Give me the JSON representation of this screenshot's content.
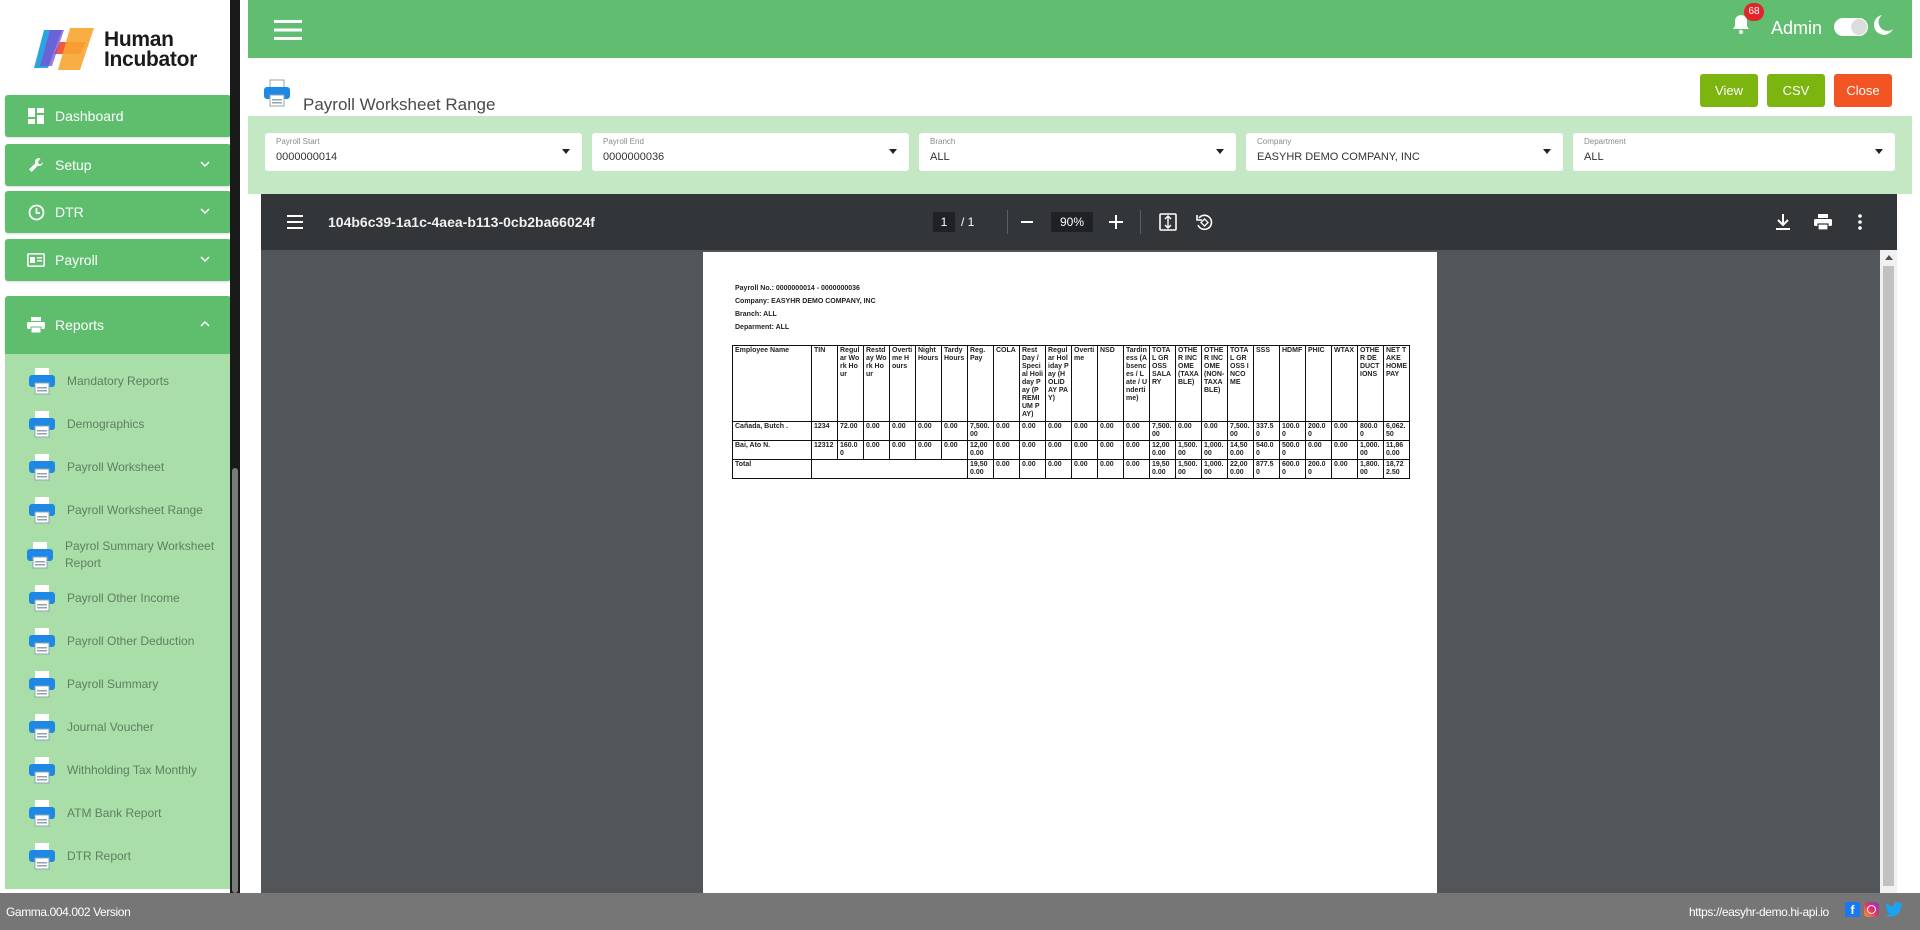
{
  "brand": {
    "logo_line1": "Human",
    "logo_line2": "Incubator"
  },
  "sidebar": {
    "menu": [
      {
        "label": "Dashboard",
        "icon": "dashboard-icon"
      },
      {
        "label": "Setup",
        "icon": "wrench-icon"
      },
      {
        "label": "DTR",
        "icon": "clock-icon"
      },
      {
        "label": "Payroll",
        "icon": "payroll-icon"
      },
      {
        "label": "Reports",
        "icon": "printer-icon"
      }
    ],
    "reports_submenu": [
      "Mandatory Reports",
      "Demographics",
      "Payroll Worksheet",
      "Payroll Worksheet Range",
      "Payrol Summary Worksheet Report",
      "Payroll Other Income",
      "Payroll Other Deduction",
      "Payroll Summary",
      "Journal Voucher",
      "Withholding Tax Monthly",
      "ATM Bank Report",
      "DTR Report"
    ]
  },
  "header": {
    "notification_count": "68",
    "user": "Admin"
  },
  "page": {
    "title": "Payroll Worksheet Range",
    "buttons": {
      "view": "View",
      "csv": "CSV",
      "close": "Close"
    }
  },
  "filters": [
    {
      "label": "Payroll Start",
      "value": "0000000014"
    },
    {
      "label": "Payroll End",
      "value": "0000000036"
    },
    {
      "label": "Branch",
      "value": "ALL"
    },
    {
      "label": "Company",
      "value": "EASYHR DEMO COMPANY, INC"
    },
    {
      "label": "Department",
      "value": "ALL"
    }
  ],
  "pdf": {
    "filename": "104b6c39-1a1c-4aea-b113-0cb2ba66024f",
    "page_current": "1",
    "page_total": "/ 1",
    "zoom": "90%",
    "meta": {
      "payroll_no": "Payroll No.: 0000000014 - 0000000036",
      "company": "Company: EASYHR DEMO COMPANY, INC",
      "branch": "Branch: ALL",
      "department": "Deparment: ALL"
    },
    "table": {
      "headers": [
        "Employee Name",
        "TIN",
        "Regular Work Hour",
        "Restday Work Hour",
        "Overtime Hours",
        "Night Hours",
        "Tardy Hours",
        "Reg. Pay",
        "COLA",
        "Rest Day / Special Holiday Pay (PREMIUM PAY)",
        "Regular Holiday Pay (HOLIDAY PAY)",
        "Overtime",
        "NSD",
        "Tardiness (Absences / Late / Undertime)",
        "TOTAL GROSS SALARY",
        "OTHER INCOME (TAXABLE)",
        "OTHER INCOME (NON-TAXABLE)",
        "TOTAL GROSS INCOME",
        "SSS",
        "HDMF",
        "PHIC",
        "WTAX",
        "OTHER DEDUCTIONS",
        "NET TAKE HOME PAY"
      ],
      "rows": [
        [
          "Cañada, Butch .",
          "1234",
          "72.00",
          "0.00",
          "0.00",
          "0.00",
          "0.00",
          "7,500.00",
          "0.00",
          "0.00",
          "0.00",
          "0.00",
          "0.00",
          "0.00",
          "7,500.00",
          "0.00",
          "0.00",
          "7,500.00",
          "337.50",
          "100.00",
          "200.00",
          "0.00",
          "800.00",
          "6,062.50"
        ],
        [
          "Bai, Ato N.",
          "12312",
          "160.00",
          "0.00",
          "0.00",
          "0.00",
          "0.00",
          "12,000.00",
          "0.00",
          "0.00",
          "0.00",
          "0.00",
          "0.00",
          "0.00",
          "12,000.00",
          "1,500.00",
          "1,000.00",
          "14,500.00",
          "540.00",
          "500.00",
          "0.00",
          "0.00",
          "1,000.00",
          "11,860.00"
        ]
      ],
      "total_label": "Total",
      "totals": [
        "19,500.00",
        "0.00",
        "0.00",
        "0.00",
        "0.00",
        "0.00",
        "0.00",
        "19,500.00",
        "1,500.00",
        "1,000.00",
        "22,000.00",
        "877.50",
        "600.00",
        "200.00",
        "0.00",
        "1,800.00",
        "18,722.50"
      ]
    }
  },
  "footer": {
    "version": "Gamma.004.002 Version",
    "url": "https://easyhr-demo.hi-api.io"
  },
  "colors": {
    "primary_green": "#61bd70",
    "light_green": "#c4e8c4",
    "view_btn": "#7cb50f",
    "close_btn": "#f25424"
  }
}
